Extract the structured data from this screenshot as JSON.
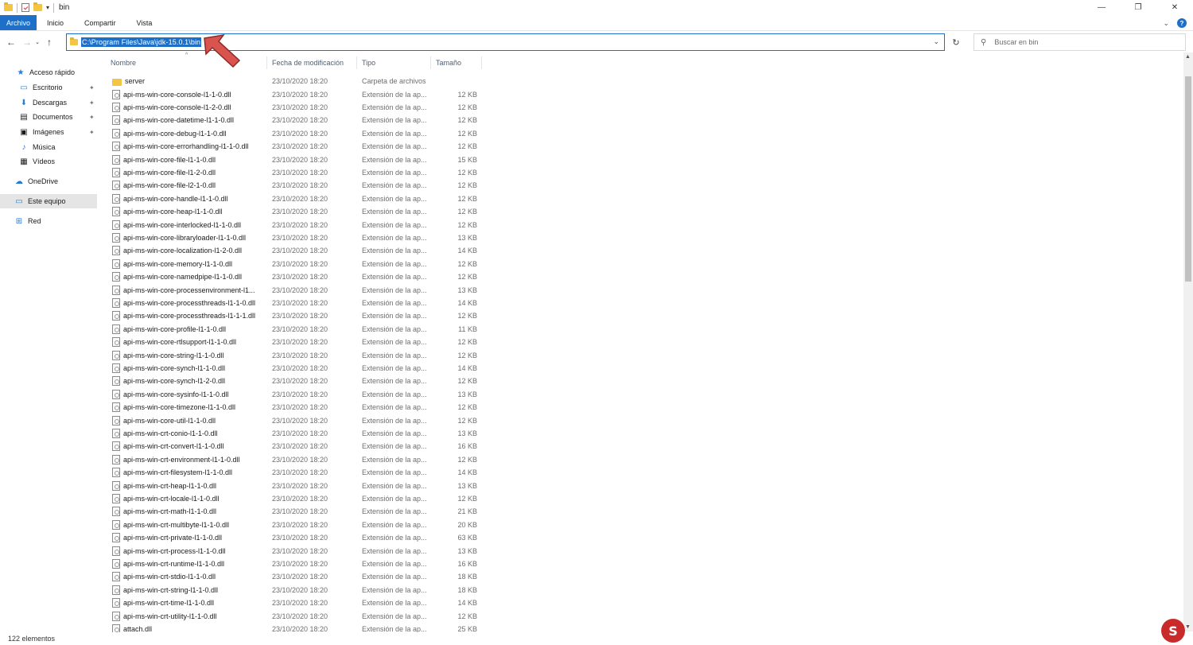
{
  "window": {
    "title": "bin",
    "minimize": "—",
    "maximize": "❐",
    "close": "✕"
  },
  "ribbon": {
    "tabs": [
      "Archivo",
      "Inicio",
      "Compartir",
      "Vista"
    ],
    "expand_icon": "chevron-down-icon",
    "help_label": "?"
  },
  "nav": {
    "back": "←",
    "forward": "→",
    "recent": "⌄",
    "up": "↑",
    "address_path": "C:\\Program Files\\Java\\jdk-15.0.1\\bin",
    "refresh": "↻",
    "search_placeholder": "Buscar en bin"
  },
  "sidebar": {
    "items": [
      {
        "label": "Acceso rápido",
        "icon": "star-icon",
        "glyph": "★"
      },
      {
        "label": "Escritorio",
        "icon": "desktop-icon",
        "glyph": "▭",
        "pinned": true
      },
      {
        "label": "Descargas",
        "icon": "download-icon",
        "glyph": "⬇",
        "pinned": true
      },
      {
        "label": "Documentos",
        "icon": "document-icon",
        "glyph": "▤",
        "pinned": true
      },
      {
        "label": "Imágenes",
        "icon": "pictures-icon",
        "glyph": "▣",
        "pinned": true
      },
      {
        "label": "Música",
        "icon": "music-icon",
        "glyph": "♪"
      },
      {
        "label": "Vídeos",
        "icon": "video-icon",
        "glyph": "▦"
      },
      {
        "label": "OneDrive",
        "icon": "cloud-icon",
        "glyph": "☁"
      },
      {
        "label": "Este equipo",
        "icon": "computer-icon",
        "glyph": "▭",
        "selected": true
      },
      {
        "label": "Red",
        "icon": "network-icon",
        "glyph": "⊞"
      }
    ]
  },
  "columns": {
    "name": "Nombre",
    "date": "Fecha de modificación",
    "type": "Tipo",
    "size": "Tamaño"
  },
  "files": [
    {
      "name": "server",
      "date": "23/10/2020 18:20",
      "type": "Carpeta de archivos",
      "size": "",
      "kind": "folder"
    },
    {
      "name": "api-ms-win-core-console-l1-1-0.dll",
      "date": "23/10/2020 18:20",
      "type": "Extensión de la ap...",
      "size": "12 KB",
      "kind": "dll"
    },
    {
      "name": "api-ms-win-core-console-l1-2-0.dll",
      "date": "23/10/2020 18:20",
      "type": "Extensión de la ap...",
      "size": "12 KB",
      "kind": "dll"
    },
    {
      "name": "api-ms-win-core-datetime-l1-1-0.dll",
      "date": "23/10/2020 18:20",
      "type": "Extensión de la ap...",
      "size": "12 KB",
      "kind": "dll"
    },
    {
      "name": "api-ms-win-core-debug-l1-1-0.dll",
      "date": "23/10/2020 18:20",
      "type": "Extensión de la ap...",
      "size": "12 KB",
      "kind": "dll"
    },
    {
      "name": "api-ms-win-core-errorhandling-l1-1-0.dll",
      "date": "23/10/2020 18:20",
      "type": "Extensión de la ap...",
      "size": "12 KB",
      "kind": "dll"
    },
    {
      "name": "api-ms-win-core-file-l1-1-0.dll",
      "date": "23/10/2020 18:20",
      "type": "Extensión de la ap...",
      "size": "15 KB",
      "kind": "dll"
    },
    {
      "name": "api-ms-win-core-file-l1-2-0.dll",
      "date": "23/10/2020 18:20",
      "type": "Extensión de la ap...",
      "size": "12 KB",
      "kind": "dll"
    },
    {
      "name": "api-ms-win-core-file-l2-1-0.dll",
      "date": "23/10/2020 18:20",
      "type": "Extensión de la ap...",
      "size": "12 KB",
      "kind": "dll"
    },
    {
      "name": "api-ms-win-core-handle-l1-1-0.dll",
      "date": "23/10/2020 18:20",
      "type": "Extensión de la ap...",
      "size": "12 KB",
      "kind": "dll"
    },
    {
      "name": "api-ms-win-core-heap-l1-1-0.dll",
      "date": "23/10/2020 18:20",
      "type": "Extensión de la ap...",
      "size": "12 KB",
      "kind": "dll"
    },
    {
      "name": "api-ms-win-core-interlocked-l1-1-0.dll",
      "date": "23/10/2020 18:20",
      "type": "Extensión de la ap...",
      "size": "12 KB",
      "kind": "dll"
    },
    {
      "name": "api-ms-win-core-libraryloader-l1-1-0.dll",
      "date": "23/10/2020 18:20",
      "type": "Extensión de la ap...",
      "size": "13 KB",
      "kind": "dll"
    },
    {
      "name": "api-ms-win-core-localization-l1-2-0.dll",
      "date": "23/10/2020 18:20",
      "type": "Extensión de la ap...",
      "size": "14 KB",
      "kind": "dll"
    },
    {
      "name": "api-ms-win-core-memory-l1-1-0.dll",
      "date": "23/10/2020 18:20",
      "type": "Extensión de la ap...",
      "size": "12 KB",
      "kind": "dll"
    },
    {
      "name": "api-ms-win-core-namedpipe-l1-1-0.dll",
      "date": "23/10/2020 18:20",
      "type": "Extensión de la ap...",
      "size": "12 KB",
      "kind": "dll"
    },
    {
      "name": "api-ms-win-core-processenvironment-l1...",
      "date": "23/10/2020 18:20",
      "type": "Extensión de la ap...",
      "size": "13 KB",
      "kind": "dll"
    },
    {
      "name": "api-ms-win-core-processthreads-l1-1-0.dll",
      "date": "23/10/2020 18:20",
      "type": "Extensión de la ap...",
      "size": "14 KB",
      "kind": "dll"
    },
    {
      "name": "api-ms-win-core-processthreads-l1-1-1.dll",
      "date": "23/10/2020 18:20",
      "type": "Extensión de la ap...",
      "size": "12 KB",
      "kind": "dll"
    },
    {
      "name": "api-ms-win-core-profile-l1-1-0.dll",
      "date": "23/10/2020 18:20",
      "type": "Extensión de la ap...",
      "size": "11 KB",
      "kind": "dll"
    },
    {
      "name": "api-ms-win-core-rtlsupport-l1-1-0.dll",
      "date": "23/10/2020 18:20",
      "type": "Extensión de la ap...",
      "size": "12 KB",
      "kind": "dll"
    },
    {
      "name": "api-ms-win-core-string-l1-1-0.dll",
      "date": "23/10/2020 18:20",
      "type": "Extensión de la ap...",
      "size": "12 KB",
      "kind": "dll"
    },
    {
      "name": "api-ms-win-core-synch-l1-1-0.dll",
      "date": "23/10/2020 18:20",
      "type": "Extensión de la ap...",
      "size": "14 KB",
      "kind": "dll"
    },
    {
      "name": "api-ms-win-core-synch-l1-2-0.dll",
      "date": "23/10/2020 18:20",
      "type": "Extensión de la ap...",
      "size": "12 KB",
      "kind": "dll"
    },
    {
      "name": "api-ms-win-core-sysinfo-l1-1-0.dll",
      "date": "23/10/2020 18:20",
      "type": "Extensión de la ap...",
      "size": "13 KB",
      "kind": "dll"
    },
    {
      "name": "api-ms-win-core-timezone-l1-1-0.dll",
      "date": "23/10/2020 18:20",
      "type": "Extensión de la ap...",
      "size": "12 KB",
      "kind": "dll"
    },
    {
      "name": "api-ms-win-core-util-l1-1-0.dll",
      "date": "23/10/2020 18:20",
      "type": "Extensión de la ap...",
      "size": "12 KB",
      "kind": "dll"
    },
    {
      "name": "api-ms-win-crt-conio-l1-1-0.dll",
      "date": "23/10/2020 18:20",
      "type": "Extensión de la ap...",
      "size": "13 KB",
      "kind": "dll"
    },
    {
      "name": "api-ms-win-crt-convert-l1-1-0.dll",
      "date": "23/10/2020 18:20",
      "type": "Extensión de la ap...",
      "size": "16 KB",
      "kind": "dll"
    },
    {
      "name": "api-ms-win-crt-environment-l1-1-0.dll",
      "date": "23/10/2020 18:20",
      "type": "Extensión de la ap...",
      "size": "12 KB",
      "kind": "dll"
    },
    {
      "name": "api-ms-win-crt-filesystem-l1-1-0.dll",
      "date": "23/10/2020 18:20",
      "type": "Extensión de la ap...",
      "size": "14 KB",
      "kind": "dll"
    },
    {
      "name": "api-ms-win-crt-heap-l1-1-0.dll",
      "date": "23/10/2020 18:20",
      "type": "Extensión de la ap...",
      "size": "13 KB",
      "kind": "dll"
    },
    {
      "name": "api-ms-win-crt-locale-l1-1-0.dll",
      "date": "23/10/2020 18:20",
      "type": "Extensión de la ap...",
      "size": "12 KB",
      "kind": "dll"
    },
    {
      "name": "api-ms-win-crt-math-l1-1-0.dll",
      "date": "23/10/2020 18:20",
      "type": "Extensión de la ap...",
      "size": "21 KB",
      "kind": "dll"
    },
    {
      "name": "api-ms-win-crt-multibyte-l1-1-0.dll",
      "date": "23/10/2020 18:20",
      "type": "Extensión de la ap...",
      "size": "20 KB",
      "kind": "dll"
    },
    {
      "name": "api-ms-win-crt-private-l1-1-0.dll",
      "date": "23/10/2020 18:20",
      "type": "Extensión de la ap...",
      "size": "63 KB",
      "kind": "dll"
    },
    {
      "name": "api-ms-win-crt-process-l1-1-0.dll",
      "date": "23/10/2020 18:20",
      "type": "Extensión de la ap...",
      "size": "13 KB",
      "kind": "dll"
    },
    {
      "name": "api-ms-win-crt-runtime-l1-1-0.dll",
      "date": "23/10/2020 18:20",
      "type": "Extensión de la ap...",
      "size": "16 KB",
      "kind": "dll"
    },
    {
      "name": "api-ms-win-crt-stdio-l1-1-0.dll",
      "date": "23/10/2020 18:20",
      "type": "Extensión de la ap...",
      "size": "18 KB",
      "kind": "dll"
    },
    {
      "name": "api-ms-win-crt-string-l1-1-0.dll",
      "date": "23/10/2020 18:20",
      "type": "Extensión de la ap...",
      "size": "18 KB",
      "kind": "dll"
    },
    {
      "name": "api-ms-win-crt-time-l1-1-0.dll",
      "date": "23/10/2020 18:20",
      "type": "Extensión de la ap...",
      "size": "14 KB",
      "kind": "dll"
    },
    {
      "name": "api-ms-win-crt-utility-l1-1-0.dll",
      "date": "23/10/2020 18:20",
      "type": "Extensión de la ap...",
      "size": "12 KB",
      "kind": "dll"
    },
    {
      "name": "attach.dll",
      "date": "23/10/2020 18:20",
      "type": "Extensión de la ap...",
      "size": "25 KB",
      "kind": "dll"
    }
  ],
  "status": {
    "count": "122 elementos"
  },
  "watermark": {
    "letter": "S"
  },
  "colors": {
    "accent": "#1e6fc7",
    "annotation_arrow": "#d9534f"
  }
}
